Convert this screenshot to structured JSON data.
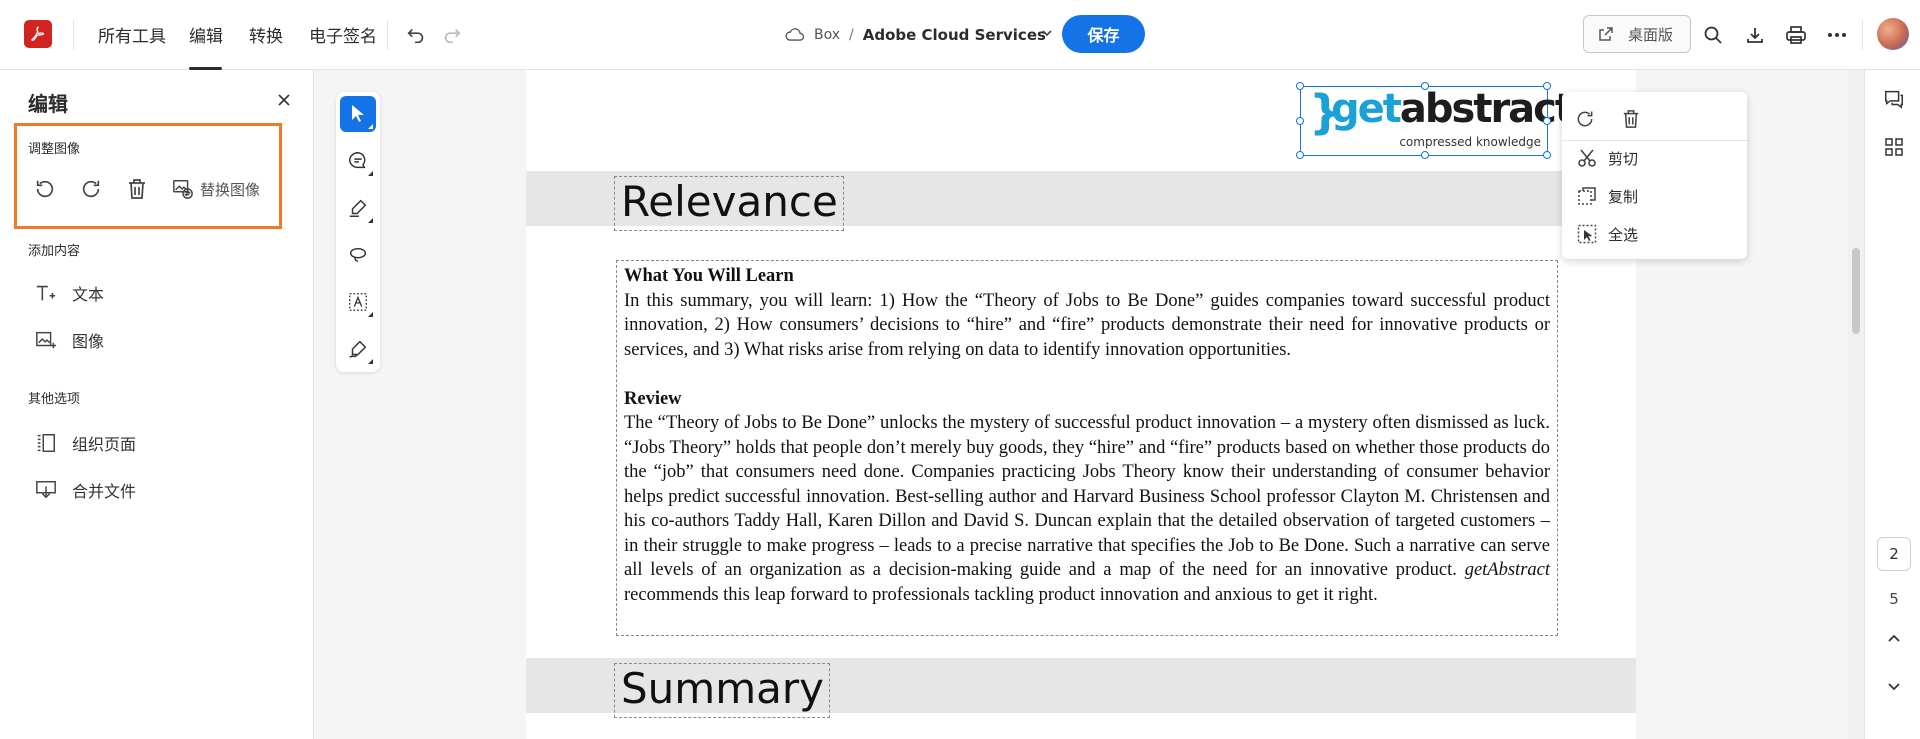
{
  "topbar": {
    "nav": [
      "所有工具",
      "编辑",
      "转换",
      "电子签名"
    ],
    "active_nav": "编辑",
    "breadcrumb": {
      "storage": "Box",
      "separator": "/",
      "document": "Adobe Cloud Services"
    },
    "save_label": "保存",
    "desktop_label": "桌面版"
  },
  "left_panel": {
    "title": "编辑",
    "adjust_section": "调整图像",
    "replace_image_label": "替换图像",
    "add_section": "添加内容",
    "add_items": [
      "文本",
      "图像"
    ],
    "other_section": "其他选项",
    "other_items": [
      "组织页面",
      "合并文件"
    ]
  },
  "document": {
    "heading1": "Relevance",
    "block": {
      "learn_title": "What You Will Learn",
      "learn_body": "In this summary, you will learn: 1) How the “Theory of Jobs to Be Done” guides companies toward successful product innovation, 2) How consumers’ decisions to “hire” and “fire” products demonstrate their need for innovative products or services, and 3) What risks arise from relying on data to identify innovation opportunities.",
      "review_title": "Review",
      "review_body_pre": "The “Theory of Jobs to Be Done” unlocks the mystery of successful product innovation – a mystery often dismissed as luck. “Jobs Theory” holds that people don’t merely buy goods, they “hire” and “fire” products based on whether those products do the “job” that consumers need done. Companies practicing Jobs Theory know their understanding of consumer behavior helps predict successful innovation. Best-selling author and Harvard Business School professor Clayton M. Christensen and his co-authors Taddy Hall, Karen Dillon and David S. Duncan explain that the detailed observation of targeted customers – in their struggle to make progress – leads to a precise narrative that specifies the Job to Be Done. Such a narrative can serve all levels of an organization as a decision-making guide and a map of the need for an innovative product. ",
      "review_body_em": "getAbstract",
      "review_body_post": " recommends this leap forward to professionals tackling product innovation and anxious to get it right."
    },
    "heading2": "Summary",
    "logo": {
      "mark": "}",
      "get": "get",
      "abstract": "abstract",
      "tagline": "compressed knowledge"
    }
  },
  "context_menu": {
    "items": [
      "剪切",
      "复制",
      "全选"
    ]
  },
  "pagination": {
    "current": "2",
    "total": "5"
  },
  "colors": {
    "accent": "#1473e6",
    "highlight": "#ee7a27",
    "brand": "#d1231f"
  }
}
